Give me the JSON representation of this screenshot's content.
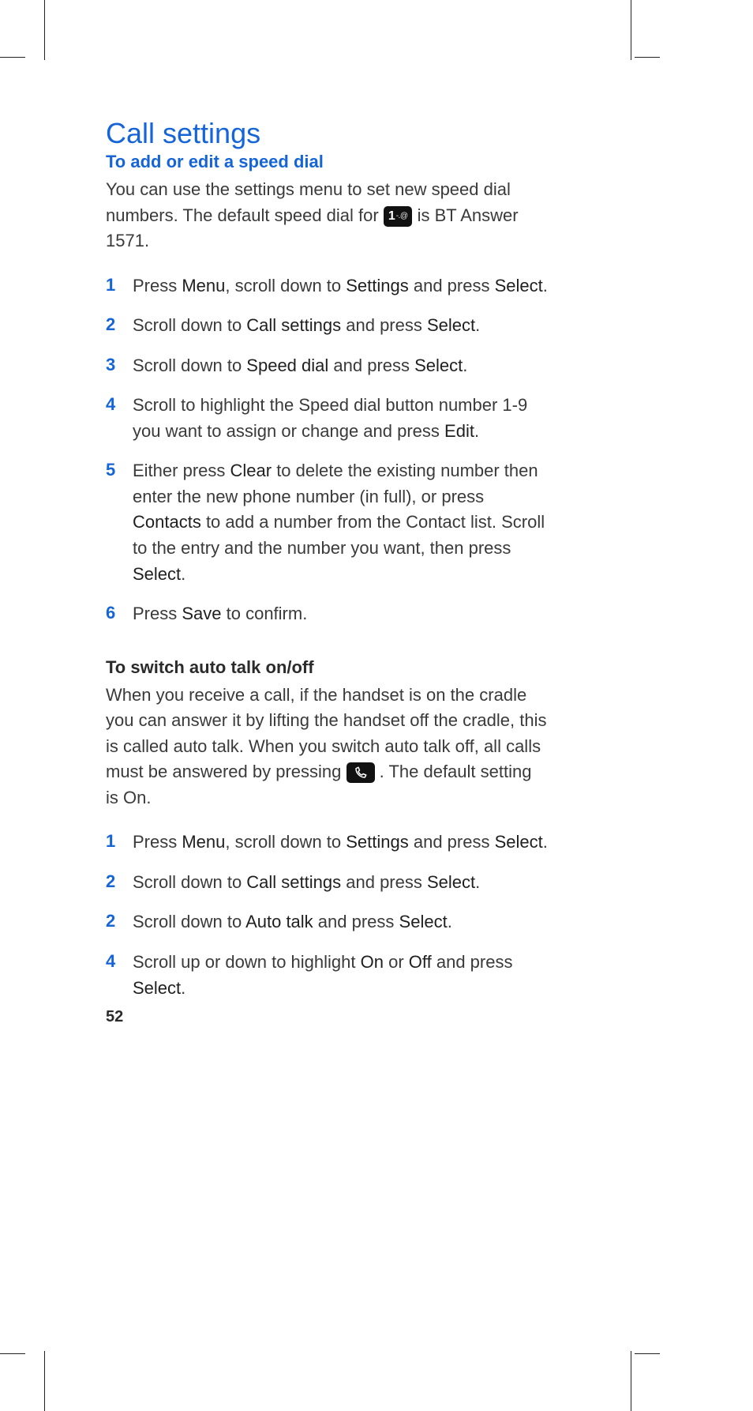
{
  "heading": "Call settings",
  "section1": {
    "title": "To add or edit a speed dial",
    "intro_a": "You can use the settings menu to set new speed dial numbers. The default speed dial for ",
    "key_label": "1",
    "key_symbols": "-.@",
    "intro_b": " is BT Answer 1571.",
    "steps": [
      {
        "n": "1",
        "parts": [
          "Press ",
          "Menu",
          ", scroll down to ",
          "Settings",
          " and press ",
          "Select",
          "."
        ]
      },
      {
        "n": "2",
        "parts": [
          "Scroll down to ",
          "Call settings",
          " and press ",
          "Select",
          "."
        ]
      },
      {
        "n": "3",
        "parts": [
          "Scroll down to ",
          "Speed dial",
          " and press ",
          "Select",
          "."
        ]
      },
      {
        "n": "4",
        "parts": [
          "Scroll to highlight the Speed dial button number 1-9 you want to assign or change and press ",
          "Edit",
          "."
        ]
      },
      {
        "n": "5",
        "parts": [
          "Either press ",
          "Clear",
          " to delete the existing number then enter the new phone number (in full), or press ",
          "Contacts",
          " to add a number from the Contact list. Scroll to the entry and the number you want, then press ",
          "Select",
          "."
        ]
      },
      {
        "n": "6",
        "parts": [
          "Press ",
          "Save",
          " to confirm."
        ]
      }
    ]
  },
  "section2": {
    "title": "To switch auto talk on/off",
    "intro_a": "When you receive a call, if the handset is on the cradle you can answer it by lifting the handset off the cradle, this is called auto talk. When you switch auto talk off, all calls must be answered by pressing ",
    "intro_b": ". The default setting is ",
    "intro_kw": "On",
    "intro_c": ".",
    "steps": [
      {
        "n": "1",
        "parts": [
          "Press ",
          "Menu",
          ", scroll down to ",
          "Settings",
          " and press ",
          "Select",
          "."
        ]
      },
      {
        "n": "2",
        "parts": [
          "Scroll down to ",
          "Call settings",
          " and press ",
          "Select",
          "."
        ]
      },
      {
        "n": "2",
        "parts": [
          "Scroll down to ",
          "Auto talk",
          " and press ",
          "Select",
          "."
        ]
      },
      {
        "n": "4",
        "parts": [
          "Scroll up or down to highlight ",
          "On",
          " or ",
          "Off",
          " and press ",
          "Select",
          "."
        ]
      }
    ]
  },
  "page_number": "52"
}
